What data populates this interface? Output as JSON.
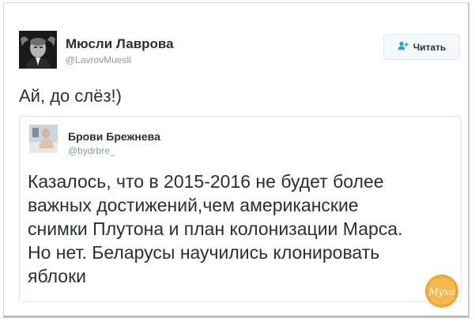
{
  "tweet": {
    "author_name": "Мюсли Лаврова",
    "author_handle": "@LavrovMuesli",
    "follow_label": "Читать",
    "text": "Ай, до слёз!)"
  },
  "quoted": {
    "author_name": "Брови Брежнева",
    "author_handle": "@bydrbre_",
    "text_lines": [
      "Казалось, что в 2015-2016 не будет более",
      "важных достижений,чем американские",
      "снимки Плутона и план колонизации Марса.",
      "Но нет. Беларусы научились клонировать",
      "яблоки"
    ]
  },
  "watermark": {
    "text": "Муха"
  },
  "colors": {
    "text_primary": "#292f33",
    "text_secondary": "#8899a6",
    "accent": "#1da1f2"
  },
  "icons": {
    "follow": "add-user-icon"
  }
}
